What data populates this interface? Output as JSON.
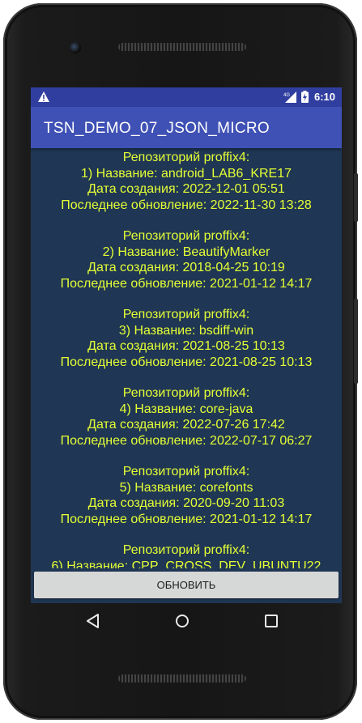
{
  "status_bar": {
    "time": "6:10",
    "network_label": "4G",
    "icons": [
      "warning-icon",
      "signal-icon",
      "battery-charging-icon"
    ]
  },
  "app_bar": {
    "title": "TSN_DEMO_07_JSON_MICRO"
  },
  "repositories": [
    {
      "header": "Репозиторий proffix4:",
      "name_line": "1) Название: android_LAB6_KRE17",
      "created_line": "Дата создания: 2022-12-01 05:51",
      "updated_line": "Последнее обновление: 2022-11-30 13:28"
    },
    {
      "header": "Репозиторий proffix4:",
      "name_line": "2) Название: BeautifyMarker",
      "created_line": "Дата создания: 2018-04-25 10:19",
      "updated_line": "Последнее обновление: 2021-01-12 14:17"
    },
    {
      "header": "Репозиторий proffix4:",
      "name_line": "3) Название: bsdiff-win",
      "created_line": "Дата создания: 2021-08-25 10:13",
      "updated_line": "Последнее обновление: 2021-08-25 10:13"
    },
    {
      "header": "Репозиторий proffix4:",
      "name_line": "4) Название: core-java",
      "created_line": "Дата создания: 2022-07-26 17:42",
      "updated_line": "Последнее обновление: 2022-07-17 06:27"
    },
    {
      "header": "Репозиторий proffix4:",
      "name_line": "5) Название: corefonts",
      "created_line": "Дата создания: 2020-09-20 11:03",
      "updated_line": "Последнее обновление: 2021-01-12 14:17"
    },
    {
      "header": "Репозиторий proffix4:",
      "name_line": "6) Название: CPP_CROSS_DEV_UBUNTU22",
      "created_line": "",
      "updated_line": ""
    }
  ],
  "refresh_button": {
    "label": "ОБНОВИТЬ"
  },
  "nav_bar": {
    "icons": [
      "back-icon",
      "home-icon",
      "recents-icon"
    ]
  },
  "colors": {
    "status_bar": "#303f9f",
    "app_bar": "#3f51b5",
    "content_background": "#1f3654",
    "list_text": "#e5ff35",
    "button_background": "#d6d7d7"
  }
}
